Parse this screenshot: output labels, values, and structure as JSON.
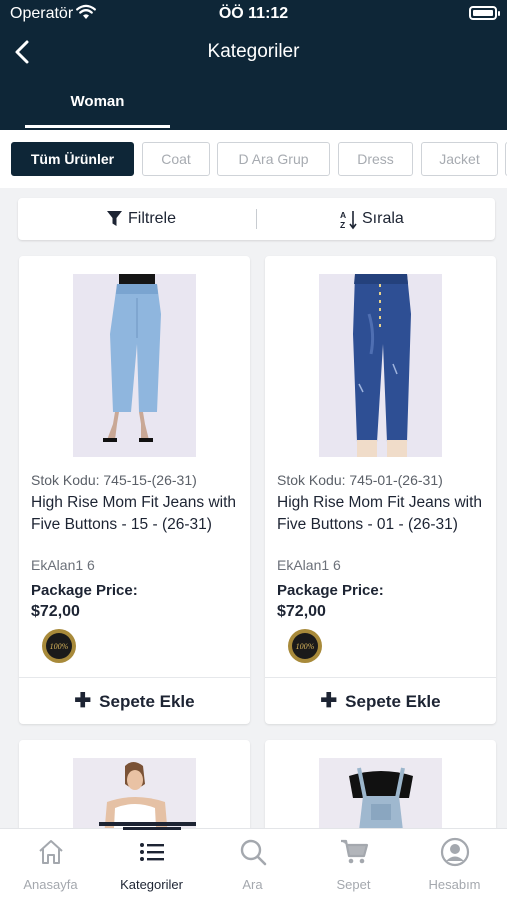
{
  "status_bar": {
    "carrier": "Operatör",
    "time": "ÖÖ 11:12"
  },
  "header": {
    "title": "Kategoriler"
  },
  "top_tabs": [
    {
      "label": "Woman"
    }
  ],
  "chips": [
    {
      "label": "Tüm Ürünler",
      "active": true
    },
    {
      "label": "Coat"
    },
    {
      "label": "D Ara Grup"
    },
    {
      "label": "Dress"
    },
    {
      "label": "Jacket"
    }
  ],
  "toolbar": {
    "filter_label": "Filtrele",
    "sort_label": "Sırala"
  },
  "products": [
    {
      "code": "Stok Kodu: 745-15-(26-31)",
      "name": "High Rise Mom Fit Jeans with Five Buttons - 15 - (26-31)",
      "extra": "EkAlan1 6",
      "price_label": "Package Price:",
      "price": "$72,00",
      "badge_text": "100%",
      "add_label": "Sepete Ekle"
    },
    {
      "code": "Stok Kodu: 745-01-(26-31)",
      "name": "High Rise Mom Fit Jeans with Five Buttons - 01 - (26-31)",
      "extra": "EkAlan1 6",
      "price_label": "Package Price:",
      "price": "$72,00",
      "badge_text": "100%",
      "add_label": "Sepete Ekle"
    }
  ],
  "bottom_nav": [
    {
      "label": "Anasayfa",
      "icon": "home-icon"
    },
    {
      "label": "Kategoriler",
      "icon": "list-icon",
      "active": true
    },
    {
      "label": "Ara",
      "icon": "search-icon"
    },
    {
      "label": "Sepet",
      "icon": "cart-icon"
    },
    {
      "label": "Hesabım",
      "icon": "account-icon"
    }
  ],
  "colors": {
    "primary": "#0e2637",
    "background": "#f1f2f4",
    "inactive": "#a4a8ae"
  }
}
